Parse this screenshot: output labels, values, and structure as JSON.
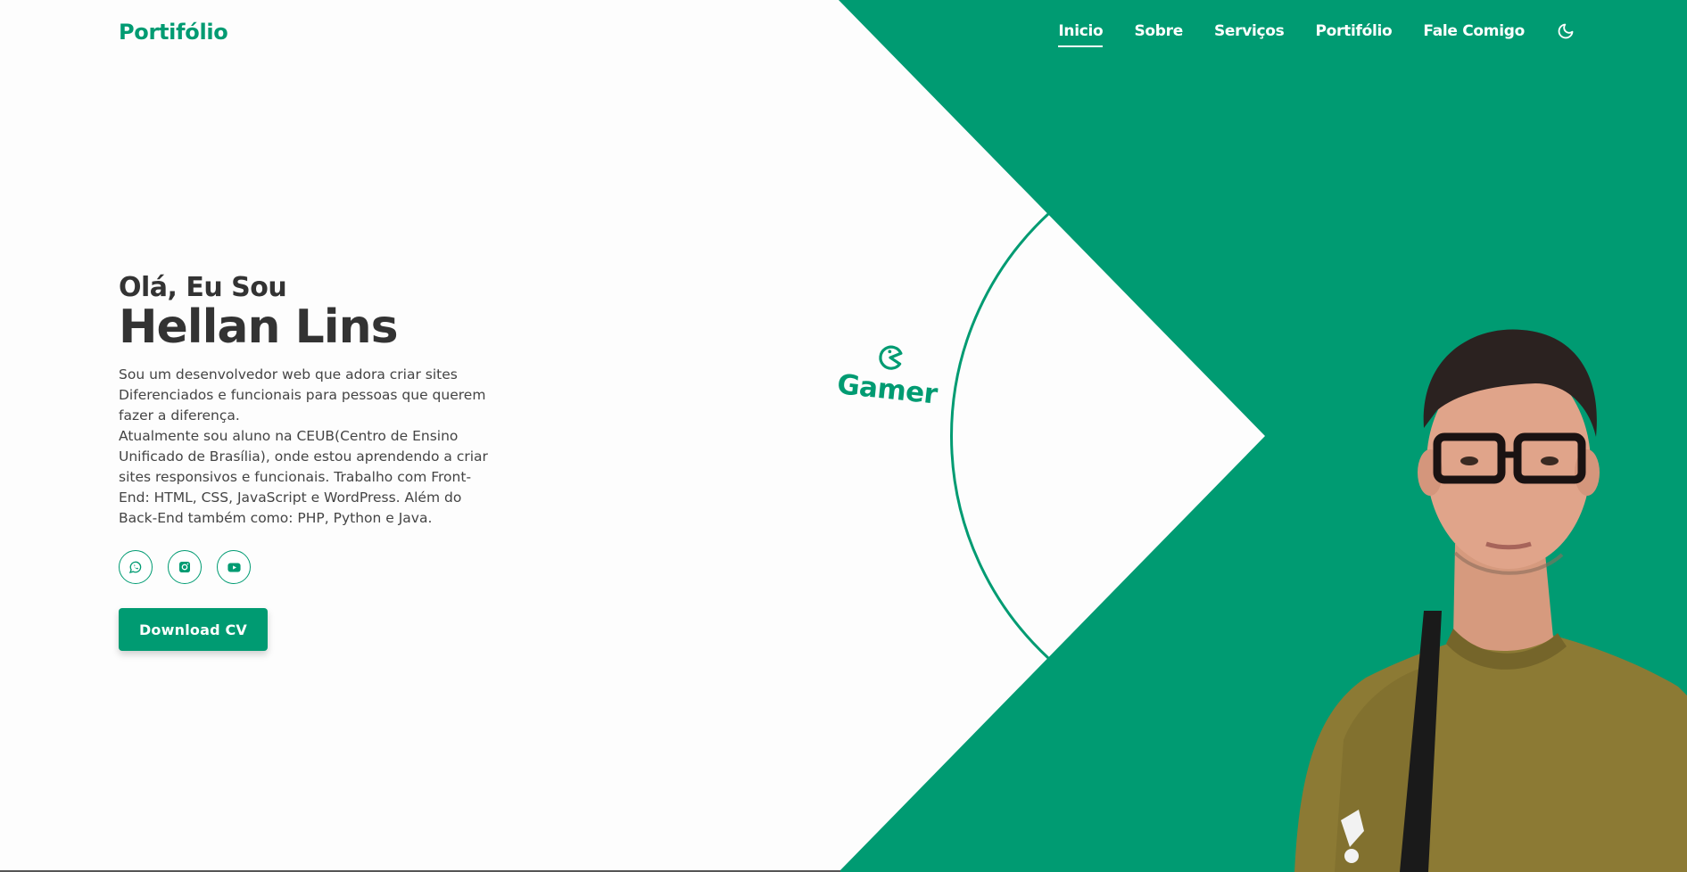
{
  "header": {
    "logo": "Portifólio",
    "nav": [
      {
        "label": "Inicio",
        "active": true
      },
      {
        "label": "Sobre",
        "active": false
      },
      {
        "label": "Serviços",
        "active": false
      },
      {
        "label": "Portifólio",
        "active": false
      },
      {
        "label": "Fale Comigo",
        "active": false
      }
    ],
    "theme_icon": "moon-icon"
  },
  "hero": {
    "greeting": "Olá, Eu Sou",
    "name": "Hellan Lins",
    "bio_line1": "Sou um desenvolvedor web que adora criar sites Diferenciados e funcionais para pessoas que querem fazer a diferença.",
    "bio_line2": "Atualmente sou aluno na CEUB(Centro de Ensino Unificado de Brasília), onde estou aprendendo a criar sites responsivos e funcionais. Trabalho com Front-End: HTML, CSS, JavaScript e WordPress. Além do Back-End também como: PHP, Python e Java.",
    "socials": [
      {
        "icon": "whatsapp-icon"
      },
      {
        "icon": "instagram-icon"
      },
      {
        "icon": "youtube-icon"
      }
    ],
    "download_label": "Download CV"
  },
  "badge": {
    "label": "Gamer",
    "icon": "pacman-icon"
  },
  "colors": {
    "accent": "#009b72",
    "text": "#333333",
    "background": "#fdfdfd"
  }
}
